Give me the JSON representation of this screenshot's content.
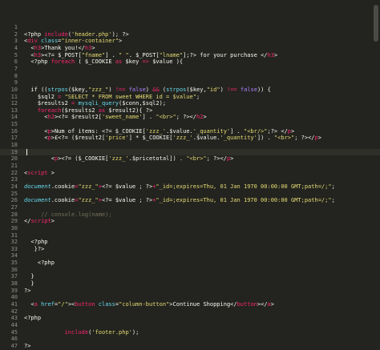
{
  "editor": {
    "lines": [
      {
        "n": "1",
        "s": []
      },
      {
        "n": "2",
        "s": [
          {
            "t": "<?php ",
            "c": "pl"
          },
          {
            "t": "include",
            "c": "kw"
          },
          {
            "t": "(",
            "c": "pl"
          },
          {
            "t": "'header.php'",
            "c": "str"
          },
          {
            "t": "); ?>",
            "c": "pl"
          }
        ]
      },
      {
        "n": "3",
        "s": [
          {
            "t": "<",
            "c": "pl"
          },
          {
            "t": "div",
            "c": "kw"
          },
          {
            "t": " class",
            "c": "fn"
          },
          {
            "t": "=",
            "c": "pl"
          },
          {
            "t": "\"inner-container\"",
            "c": "str"
          },
          {
            "t": ">",
            "c": "pl"
          }
        ]
      },
      {
        "n": "4",
        "s": [
          {
            "t": "  <",
            "c": "pl"
          },
          {
            "t": "h3",
            "c": "kw"
          },
          {
            "t": ">Thank you!</",
            "c": "pl"
          },
          {
            "t": "h3",
            "c": "kw"
          },
          {
            "t": ">",
            "c": "pl"
          }
        ]
      },
      {
        "n": "5",
        "s": [
          {
            "t": "  <",
            "c": "pl"
          },
          {
            "t": "h3",
            "c": "kw"
          },
          {
            "t": "><?= $_POST[",
            "c": "pl"
          },
          {
            "t": "\"fname\"",
            "c": "str"
          },
          {
            "t": "] . ",
            "c": "pl"
          },
          {
            "t": "\" \"",
            "c": "str"
          },
          {
            "t": ". $_POST[",
            "c": "pl"
          },
          {
            "t": "\"lname\"",
            "c": "str"
          },
          {
            "t": "];?> for your purchase </",
            "c": "pl"
          },
          {
            "t": "h3",
            "c": "kw"
          },
          {
            "t": ">",
            "c": "pl"
          }
        ]
      },
      {
        "n": "6",
        "s": [
          {
            "t": "  <?php ",
            "c": "pl"
          },
          {
            "t": "foreach",
            "c": "kw"
          },
          {
            "t": " ( $_COOKIE ",
            "c": "pl"
          },
          {
            "t": "as",
            "c": "kw"
          },
          {
            "t": " $key ",
            "c": "pl"
          },
          {
            "t": "=>",
            "c": "kw"
          },
          {
            "t": " $value ){",
            "c": "pl"
          }
        ]
      },
      {
        "n": "7",
        "s": []
      },
      {
        "n": "8",
        "s": []
      },
      {
        "n": "9",
        "s": []
      },
      {
        "n": "10",
        "s": [
          {
            "t": "  if ((",
            "c": "pl"
          },
          {
            "t": "strpos",
            "c": "fn"
          },
          {
            "t": "($key,",
            "c": "pl"
          },
          {
            "t": "\"zzz_\"",
            "c": "str"
          },
          {
            "t": ") ",
            "c": "pl"
          },
          {
            "t": "!==",
            "c": "kw"
          },
          {
            "t": " ",
            "c": "pl"
          },
          {
            "t": "false",
            "c": "num"
          },
          {
            "t": ") ",
            "c": "pl"
          },
          {
            "t": "&&",
            "c": "kw"
          },
          {
            "t": " (",
            "c": "pl"
          },
          {
            "t": "strpos",
            "c": "fn"
          },
          {
            "t": "($key,",
            "c": "pl"
          },
          {
            "t": "\"id\"",
            "c": "str"
          },
          {
            "t": ") ",
            "c": "pl"
          },
          {
            "t": "!==",
            "c": "kw"
          },
          {
            "t": " ",
            "c": "pl"
          },
          {
            "t": "false",
            "c": "num"
          },
          {
            "t": ")) {",
            "c": "pl"
          }
        ]
      },
      {
        "n": "11",
        "s": [
          {
            "t": "    $sql2 ",
            "c": "pl"
          },
          {
            "t": "=",
            "c": "kw"
          },
          {
            "t": " ",
            "c": "pl"
          },
          {
            "t": "\"SELECT * FROM sweet WHERE id = $value\"",
            "c": "str"
          },
          {
            "t": ";",
            "c": "pl"
          }
        ]
      },
      {
        "n": "12",
        "s": [
          {
            "t": "    $results2 ",
            "c": "pl"
          },
          {
            "t": "=",
            "c": "kw"
          },
          {
            "t": " ",
            "c": "pl"
          },
          {
            "t": "mysqli_query",
            "c": "fn"
          },
          {
            "t": "($conn,$sql2);",
            "c": "pl"
          }
        ]
      },
      {
        "n": "13",
        "s": [
          {
            "t": "    ",
            "c": "pl"
          },
          {
            "t": "foreach",
            "c": "kw"
          },
          {
            "t": "($results2 ",
            "c": "pl"
          },
          {
            "t": "as",
            "c": "kw"
          },
          {
            "t": " $result2){ ?>",
            "c": "pl"
          }
        ]
      },
      {
        "n": "14",
        "s": [
          {
            "t": "      <",
            "c": "pl"
          },
          {
            "t": "h2",
            "c": "kw"
          },
          {
            "t": "><?= $result2[",
            "c": "pl"
          },
          {
            "t": "'sweet_name'",
            "c": "str"
          },
          {
            "t": "] . ",
            "c": "pl"
          },
          {
            "t": "\"<br>\"",
            "c": "str"
          },
          {
            "t": "; ?></",
            "c": "pl"
          },
          {
            "t": "h2",
            "c": "kw"
          },
          {
            "t": ">",
            "c": "pl"
          }
        ]
      },
      {
        "n": "15",
        "s": []
      },
      {
        "n": "16",
        "s": [
          {
            "t": "      <",
            "c": "pl"
          },
          {
            "t": "p",
            "c": "kw"
          },
          {
            "t": ">Num of items: <?= $_COOKIE[",
            "c": "pl"
          },
          {
            "t": "'zzz_'",
            "c": "str"
          },
          {
            "t": ".$value.",
            "c": "pl"
          },
          {
            "t": "'_quantity'",
            "c": "str"
          },
          {
            "t": "] . ",
            "c": "pl"
          },
          {
            "t": "\"<br/>\"",
            "c": "str"
          },
          {
            "t": ";?> </",
            "c": "pl"
          },
          {
            "t": "p",
            "c": "kw"
          },
          {
            "t": ">",
            "c": "pl"
          }
        ]
      },
      {
        "n": "17",
        "s": [
          {
            "t": "      <",
            "c": "pl"
          },
          {
            "t": "p",
            "c": "kw"
          },
          {
            "t": ">£<?= ($result2[",
            "c": "pl"
          },
          {
            "t": "'price'",
            "c": "str"
          },
          {
            "t": "] * $_COOKIE[",
            "c": "pl"
          },
          {
            "t": "'zzz_'",
            "c": "str"
          },
          {
            "t": ".$value.",
            "c": "pl"
          },
          {
            "t": "'_quantity'",
            "c": "str"
          },
          {
            "t": "]) . ",
            "c": "pl"
          },
          {
            "t": "\"<br>\"",
            "c": "str"
          },
          {
            "t": "; ?></",
            "c": "pl"
          },
          {
            "t": "p",
            "c": "kw"
          },
          {
            "t": ">",
            "c": "pl"
          }
        ]
      },
      {
        "n": "18",
        "s": []
      },
      {
        "n": "19",
        "s": []
      },
      {
        "n": "20",
        "s": [
          {
            "t": "        <",
            "c": "pl"
          },
          {
            "t": "p",
            "c": "kw"
          },
          {
            "t": "><?= ($_COOKIE[",
            "c": "pl"
          },
          {
            "t": "'zzz_'",
            "c": "str"
          },
          {
            "t": ".$pricetotal]) . ",
            "c": "pl"
          },
          {
            "t": "\"<br>\"",
            "c": "str"
          },
          {
            "t": "; ?></",
            "c": "pl"
          },
          {
            "t": "p",
            "c": "kw"
          },
          {
            "t": ">",
            "c": "pl"
          }
        ]
      },
      {
        "n": "21",
        "s": []
      },
      {
        "n": "22",
        "s": [
          {
            "t": "<",
            "c": "pl"
          },
          {
            "t": "script",
            "c": "kw"
          },
          {
            "t": " >",
            "c": "pl"
          }
        ]
      },
      {
        "n": "23",
        "s": []
      },
      {
        "n": "24",
        "s": [
          {
            "t": "document",
            "c": "fn-i"
          },
          {
            "t": ".cookie",
            "c": "pl"
          },
          {
            "t": "=",
            "c": "kw"
          },
          {
            "t": "\"zzz_\"",
            "c": "str"
          },
          {
            "t": "+",
            "c": "kw"
          },
          {
            "t": "<?= $value ; ?>",
            "c": "pl"
          },
          {
            "t": "+",
            "c": "kw"
          },
          {
            "t": "\"_id=;expires=Thu, 01 Jan 1970 00:00:00 GMT;path=/;\"",
            "c": "str"
          },
          {
            "t": ";",
            "c": "pl"
          }
        ]
      },
      {
        "n": "25",
        "s": []
      },
      {
        "n": "26",
        "s": [
          {
            "t": "document",
            "c": "fn-i"
          },
          {
            "t": ".cookie",
            "c": "pl"
          },
          {
            "t": "=",
            "c": "kw"
          },
          {
            "t": "\"zzz_\"",
            "c": "str"
          },
          {
            "t": "+",
            "c": "kw"
          },
          {
            "t": "<?= $value ; ?>",
            "c": "pl"
          },
          {
            "t": "+",
            "c": "kw"
          },
          {
            "t": "\"_id=;expires=Thu, 01 Jan 1970 00:00:00 GMT;path=/;\"",
            "c": "str"
          },
          {
            "t": ";",
            "c": "pl"
          }
        ]
      },
      {
        "n": "27",
        "s": []
      },
      {
        "n": "28",
        "s": [
          {
            "t": "     // console.log(name);",
            "c": "cmt"
          }
        ]
      },
      {
        "n": "29",
        "s": [
          {
            "t": "</",
            "c": "pl"
          },
          {
            "t": "script",
            "c": "kw"
          },
          {
            "t": ">",
            "c": "pl"
          }
        ]
      },
      {
        "n": "30",
        "s": []
      },
      {
        "n": "31",
        "s": []
      },
      {
        "n": "32",
        "s": [
          {
            "t": "  <?php",
            "c": "pl"
          }
        ]
      },
      {
        "n": "33",
        "s": [
          {
            "t": "   }?>",
            "c": "pl"
          }
        ]
      },
      {
        "n": "34",
        "s": []
      },
      {
        "n": "35",
        "s": [
          {
            "t": "    <?php",
            "c": "pl"
          }
        ]
      },
      {
        "n": "36",
        "s": []
      },
      {
        "n": "37",
        "s": [
          {
            "t": "  }",
            "c": "pl"
          }
        ]
      },
      {
        "n": "38",
        "s": [
          {
            "t": "  }",
            "c": "pl"
          }
        ]
      },
      {
        "n": "39",
        "s": [
          {
            "t": "?>",
            "c": "pl"
          }
        ]
      },
      {
        "n": "40",
        "s": []
      },
      {
        "n": "41",
        "s": [
          {
            "t": "  <",
            "c": "pl"
          },
          {
            "t": "a",
            "c": "kw"
          },
          {
            "t": " href",
            "c": "fn"
          },
          {
            "t": "=",
            "c": "pl"
          },
          {
            "t": "\"/\"",
            "c": "str"
          },
          {
            "t": "><",
            "c": "pl"
          },
          {
            "t": "button",
            "c": "kw"
          },
          {
            "t": " class",
            "c": "fn"
          },
          {
            "t": "=",
            "c": "pl"
          },
          {
            "t": "\"column-button\"",
            "c": "str"
          },
          {
            "t": ">Continue Shopping</",
            "c": "pl"
          },
          {
            "t": "button",
            "c": "kw"
          },
          {
            "t": "></",
            "c": "pl"
          },
          {
            "t": "a",
            "c": "kw"
          },
          {
            "t": ">",
            "c": "pl"
          }
        ]
      },
      {
        "n": "42",
        "s": []
      },
      {
        "n": "43",
        "s": [
          {
            "t": "<?php",
            "c": "pl"
          }
        ]
      },
      {
        "n": "44",
        "s": []
      },
      {
        "n": "45",
        "s": [
          {
            "t": "            ",
            "c": "pl"
          },
          {
            "t": "include",
            "c": "kw"
          },
          {
            "t": "(",
            "c": "pl"
          },
          {
            "t": "'footer.php'",
            "c": "str"
          },
          {
            "t": ");",
            "c": "pl"
          }
        ]
      },
      {
        "n": "46",
        "s": []
      },
      {
        "n": "47",
        "s": [
          {
            "t": "?>",
            "c": "pl"
          }
        ]
      }
    ],
    "palette": {
      "background": "#23241f",
      "keyword": "#f92672",
      "string": "#e6db74",
      "function": "#66d9ef",
      "comment": "#75715e",
      "constant": "#ae81ff",
      "plain": "#f8f8f2",
      "line_number": "#8f908a"
    }
  }
}
